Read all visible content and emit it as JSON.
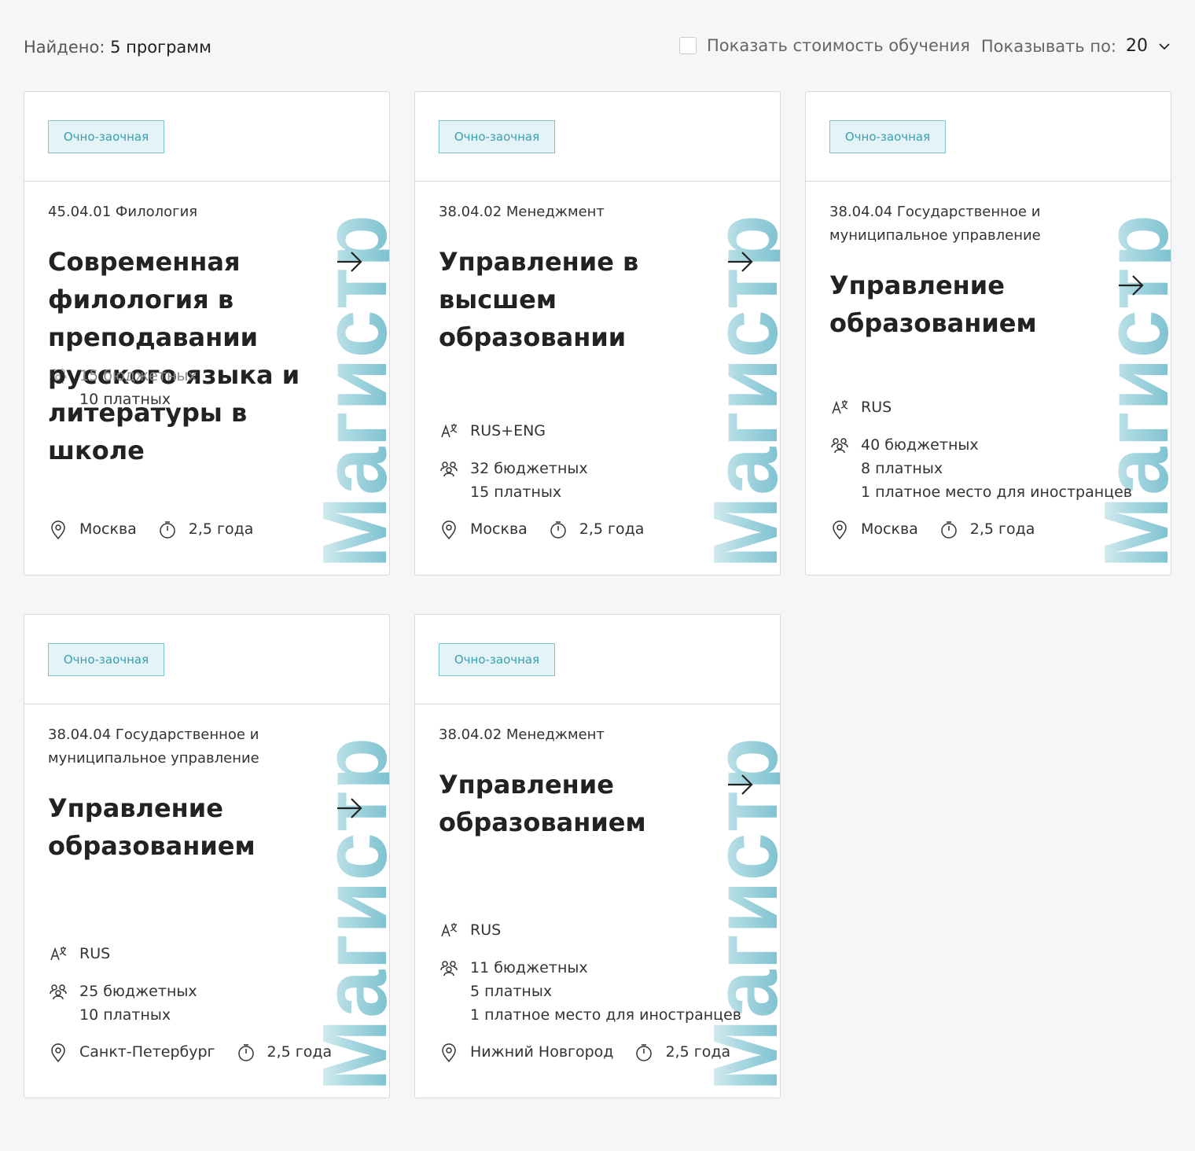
{
  "header": {
    "found_label": "Найдено:",
    "found_count": "5 программ",
    "show_cost_label": "Показать стоимость обучения",
    "per_page_label": "Показывать по:",
    "per_page_value": "20"
  },
  "colors": {
    "accent": "#7fc3cf",
    "watermark_top": "#e9f5f7",
    "watermark_bottom": "#6bb8c8"
  },
  "watermark_text": "Магистр",
  "cards": [
    {
      "form": "Очно-заочная",
      "code": "45.04.01 Филология",
      "title": "Современная филология в преподавании русского языка и литературы в школе",
      "language": "",
      "budget": "15 бюджетных",
      "paid": "10 платных",
      "foreign": "",
      "city": "Москва",
      "duration": "2,5 года"
    },
    {
      "form": "Очно-заочная",
      "code": "38.04.02 Менеджмент",
      "title": "Управление в высшем образовании",
      "language": "RUS+ENG",
      "budget": "32 бюджетных",
      "paid": "15 платных",
      "foreign": "",
      "city": "Москва",
      "duration": "2,5 года"
    },
    {
      "form": "Очно-заочная",
      "code": "38.04.04 Государственное и муниципальное управление",
      "title": "Управление образованием",
      "language": "RUS",
      "budget": "40 бюджетных",
      "paid": "8 платных",
      "foreign": "1 платное место для иностранцев",
      "city": "Москва",
      "duration": "2,5 года"
    },
    {
      "form": "Очно-заочная",
      "code": "38.04.04 Государственное и муниципальное управление",
      "title": "Управление образованием",
      "language": "RUS",
      "budget": "25 бюджетных",
      "paid": "10 платных",
      "foreign": "",
      "city": "Санкт-Петербург",
      "duration": "2,5 года"
    },
    {
      "form": "Очно-заочная",
      "code": "38.04.02 Менеджмент",
      "title": "Управление образованием",
      "language": "RUS",
      "budget": "11 бюджетных",
      "paid": "5 платных",
      "foreign": "1 платное место для иностранцев",
      "city": "Нижний Новгород",
      "duration": "2,5 года"
    }
  ]
}
